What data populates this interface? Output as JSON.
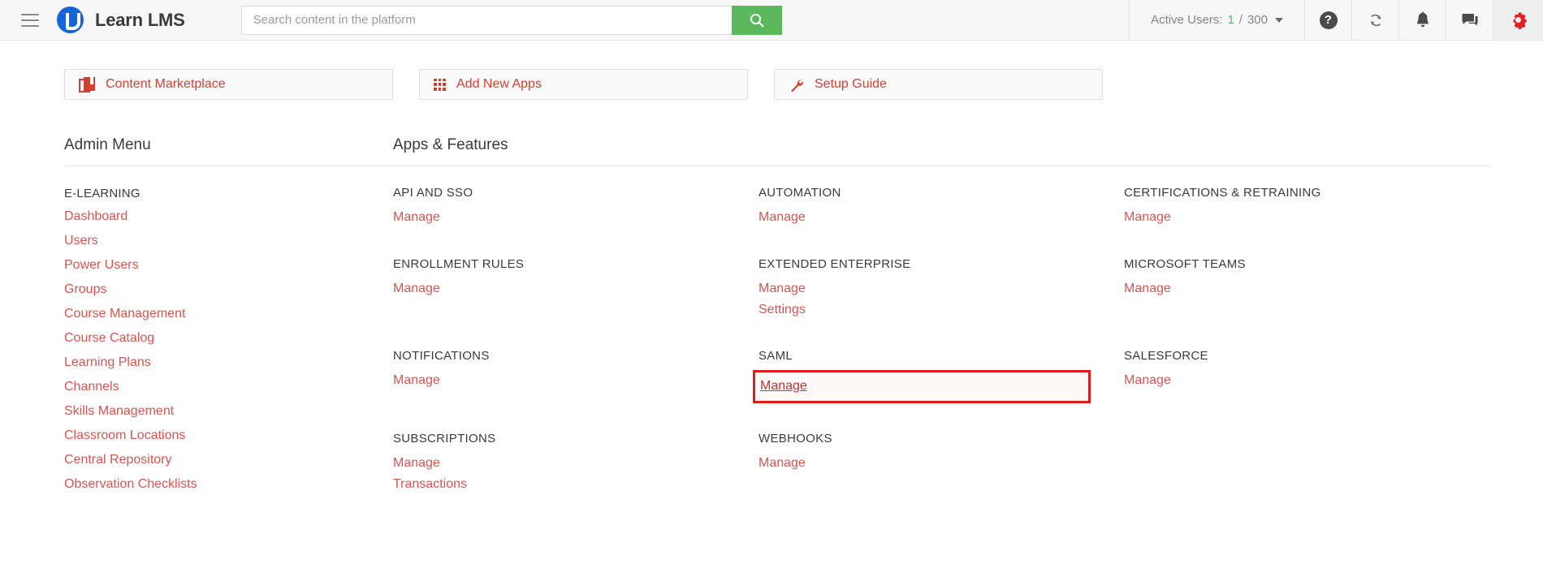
{
  "header": {
    "menu_icon": "hamburger-icon",
    "brand": "Learn LMS",
    "search_placeholder": "Search content in the platform",
    "search_value": "",
    "search_icon": "search-icon",
    "active_users_label": "Active Users:",
    "active_users_count": "1",
    "active_users_sep": "/",
    "active_users_max": "300",
    "help_icon": "?",
    "icons": {
      "help": "help-icon",
      "sync": "sync-icon",
      "bell": "bell-icon",
      "chat": "chat-icon",
      "gear": "gear-icon"
    },
    "colors": {
      "search_button": "#5cb85c",
      "active_count": "#5cb85c",
      "gear": "#e02020",
      "logo": "#1565d8"
    }
  },
  "action_buttons": [
    {
      "label": "Content Marketplace",
      "icon": "book-icon"
    },
    {
      "label": "Add New Apps",
      "icon": "grid-icon"
    },
    {
      "label": "Setup Guide",
      "icon": "wrench-icon"
    }
  ],
  "sidebar": {
    "title": "Admin Menu",
    "group_label": "E-LEARNING",
    "items": [
      {
        "label": "Dashboard"
      },
      {
        "label": "Users"
      },
      {
        "label": "Power Users"
      },
      {
        "label": "Groups"
      },
      {
        "label": "Course Management"
      },
      {
        "label": "Course Catalog"
      },
      {
        "label": "Learning Plans"
      },
      {
        "label": "Channels"
      },
      {
        "label": "Skills Management"
      },
      {
        "label": "Classroom Locations"
      },
      {
        "label": "Central Repository"
      },
      {
        "label": "Observation Checklists"
      }
    ]
  },
  "apps": {
    "title": "Apps & Features",
    "items": [
      {
        "name": "API AND SSO",
        "links": [
          "Manage"
        ],
        "highlighted": false
      },
      {
        "name": "AUTOMATION",
        "links": [
          "Manage"
        ],
        "highlighted": false
      },
      {
        "name": "CERTIFICATIONS & RETRAINING",
        "links": [
          "Manage"
        ],
        "highlighted": false
      },
      {
        "name": "ENROLLMENT RULES",
        "links": [
          "Manage"
        ],
        "highlighted": false
      },
      {
        "name": "EXTENDED ENTERPRISE",
        "links": [
          "Manage",
          "Settings"
        ],
        "highlighted": false
      },
      {
        "name": "MICROSOFT TEAMS",
        "links": [
          "Manage"
        ],
        "highlighted": false
      },
      {
        "name": "NOTIFICATIONS",
        "links": [
          "Manage"
        ],
        "highlighted": false
      },
      {
        "name": "SAML",
        "links": [
          "Manage"
        ],
        "highlighted": true
      },
      {
        "name": "SALESFORCE",
        "links": [
          "Manage"
        ],
        "highlighted": false
      },
      {
        "name": "SUBSCRIPTIONS",
        "links": [
          "Manage",
          "Transactions"
        ],
        "highlighted": false
      },
      {
        "name": "WEBHOOKS",
        "links": [
          "Manage"
        ],
        "highlighted": false
      }
    ],
    "highlight_color": "#e01b1b"
  }
}
